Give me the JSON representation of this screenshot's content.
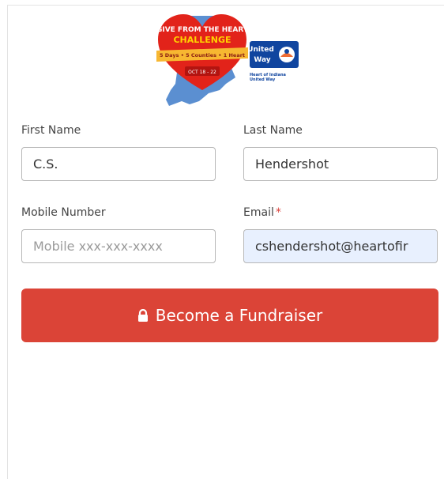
{
  "logo": {
    "heart_line1": "GIVE FROM THE HEART",
    "heart_line2": "CHALLENGE",
    "ribbon": "5 Days • 5 Counties • 1 Heart",
    "dates": "OCT 18 - 22",
    "uw_line1": "United",
    "uw_line2": "Way",
    "uw_org1": "Heart of Indiana",
    "uw_org2": "United Way"
  },
  "form": {
    "first_name": {
      "label": "First Name",
      "value": "C.S."
    },
    "last_name": {
      "label": "Last Name",
      "value": "Hendershot"
    },
    "mobile": {
      "label": "Mobile Number",
      "value": "",
      "placeholder": "Mobile xxx-xxx-xxxx"
    },
    "email": {
      "label": "Email",
      "required_mark": "*",
      "value": "cshendershot@heartofir"
    },
    "submit_label": "Become a Fundraiser"
  },
  "colors": {
    "button": "#db4437",
    "required": "#d9403a",
    "autofill_bg": "#e8f0fe",
    "heart_red": "#e2231a",
    "indiana_blue": "#5b8fd1",
    "united_way_blue": "#10459f"
  }
}
